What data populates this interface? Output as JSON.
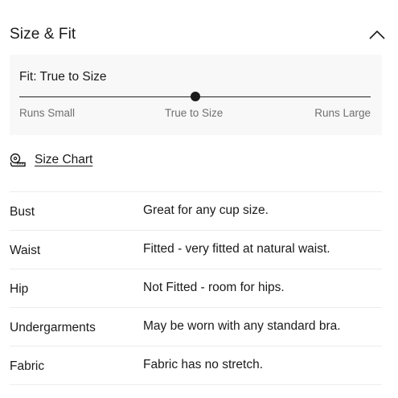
{
  "section": {
    "title": "Size & Fit",
    "toggle_icon": "chevron-up-icon"
  },
  "fit": {
    "label": "Fit: True to Size",
    "scale": [
      "Runs Small",
      "True to Size",
      "Runs Large"
    ],
    "position": 0.5
  },
  "size_chart": {
    "icon": "tape-measure-icon",
    "label": "Size Chart"
  },
  "details": [
    {
      "label": "Bust",
      "value": "Great for any cup size."
    },
    {
      "label": "Waist",
      "value": "Fitted - very fitted at natural waist."
    },
    {
      "label": "Hip",
      "value": "Not Fitted - room for hips."
    },
    {
      "label": "Undergarments",
      "value": "May be worn with any standard bra."
    },
    {
      "label": "Fabric",
      "value": "Fabric has no stretch."
    }
  ]
}
